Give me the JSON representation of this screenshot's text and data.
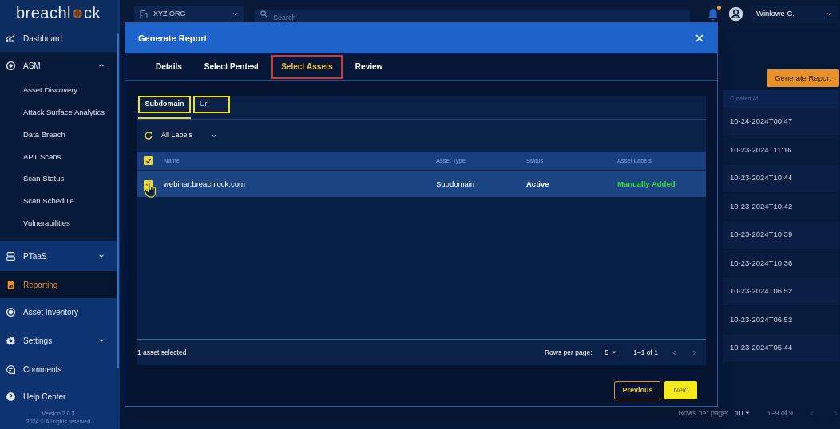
{
  "sidebar": {
    "logo": {
      "before": "breachl",
      "after": "ck"
    },
    "items": [
      {
        "kind": "link",
        "label": "Dashboard",
        "selected": false
      },
      {
        "kind": "group",
        "label": "ASM",
        "selected": false,
        "expanded": true,
        "children": [
          {
            "label": "Asset Discovery"
          },
          {
            "label": "Attack Surface Analytics"
          },
          {
            "label": "Data Breach"
          },
          {
            "label": "APT Scans"
          },
          {
            "label": "Scan Status"
          },
          {
            "label": "Scan Schedule"
          },
          {
            "label": "Vulnerabilities"
          }
        ]
      },
      {
        "kind": "group",
        "label": "PTaaS",
        "selected": false,
        "expanded": false
      },
      {
        "kind": "link",
        "label": "Reporting",
        "selected": true
      },
      {
        "kind": "link",
        "label": "Asset Inventory",
        "selected": false
      },
      {
        "kind": "group",
        "label": "Settings",
        "selected": false,
        "expanded": false
      },
      {
        "kind": "link",
        "label": "Comments",
        "selected": false
      },
      {
        "kind": "link",
        "label": "Help Center",
        "selected": false
      }
    ],
    "version": "Version 2.0.3",
    "copyright": "2024 © All rights reserved"
  },
  "topbar": {
    "org": "XYZ ORG",
    "search_placeholder": "Search",
    "notification": true,
    "user": "Winlowe C."
  },
  "page": {
    "generate_button": "Generate Report",
    "column": "Created At",
    "rows": [
      "10-24-2024T00:47",
      "10-23-2024T11:16",
      "10-23-2024T10:44",
      "10-23-2024T10:42",
      "10-23-2024T10:39",
      "10-23-2024T10:36",
      "10-23-2024T06:52",
      "10-23-2024T06:52",
      "10-23-2024T05:44"
    ],
    "rows_per_page_label": "Rows per page:",
    "rows_per_page": "10",
    "range": "1–9 of 9"
  },
  "dialog": {
    "title": "Generate Report",
    "steps": [
      {
        "label": "Details",
        "selected": false
      },
      {
        "label": "Select Pentest",
        "selected": false
      },
      {
        "label": "Select Assets",
        "selected": true
      },
      {
        "label": "Review",
        "selected": false
      }
    ],
    "asset_tabs": [
      {
        "label": "Subdomain",
        "selected": true
      },
      {
        "label": "Url",
        "selected": false
      }
    ],
    "filter": "All Labels",
    "table": {
      "all_checked": true,
      "columns": [
        "Name",
        "Asset Type",
        "Status",
        "Asset Labels"
      ],
      "rows": [
        {
          "cells": [
            "webinar.breachlock.com",
            "Subdomain",
            "Active",
            "Manually Added"
          ],
          "checked": true,
          "selected": true
        }
      ]
    },
    "selection_note": "1 asset selected",
    "rows_per_page_label": "Rows per page:",
    "rows_per_page": "5",
    "range": "1–1 of 1",
    "buttons": {
      "previous": "Previous",
      "next": "Next"
    }
  }
}
